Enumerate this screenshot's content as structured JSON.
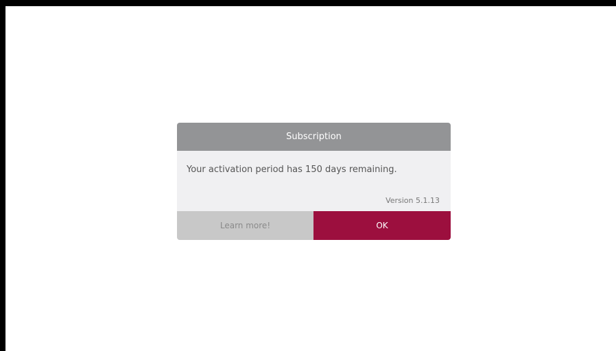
{
  "dialog": {
    "title": "Subscription",
    "message": "Your activation period has 150 days remaining.",
    "version": "Version 5.1.13",
    "buttons": {
      "learn_more": "Learn more!",
      "ok": "OK"
    }
  },
  "colors": {
    "header_bg": "#939496",
    "body_bg": "#f0f0f2",
    "secondary_button_bg": "#c8c8c8",
    "primary_button_bg": "#9c0f3e"
  }
}
